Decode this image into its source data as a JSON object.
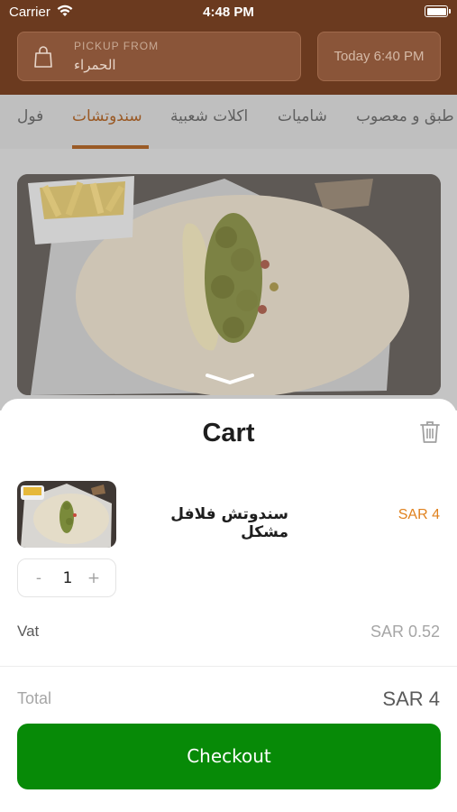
{
  "status_bar": {
    "carrier": "Carrier",
    "time": "4:48 PM"
  },
  "header": {
    "pickup_label": "PICKUP FROM",
    "pickup_location": "الحمراء",
    "pickup_time": "Today 6:40 PM"
  },
  "categories": [
    {
      "label": "فول",
      "active": false
    },
    {
      "label": "سندوتشات",
      "active": true
    },
    {
      "label": "اكلات شعبية",
      "active": false
    },
    {
      "label": "شاميات",
      "active": false
    },
    {
      "label": "طبق و معصوب",
      "active": false
    }
  ],
  "cart": {
    "title": "Cart",
    "item": {
      "name": "سندوتش فلافل مشكل",
      "price": "SAR 4",
      "quantity": "1",
      "minus": "-",
      "plus": "+"
    },
    "vat_label": "Vat",
    "vat_value": "SAR 0.52",
    "total_label": "Total",
    "total_value": "SAR 4",
    "checkout_label": "Checkout"
  },
  "colors": {
    "header_brown": "#6b3a1f",
    "active_tab": "#9a5a26",
    "price_orange": "#e0821f",
    "checkout_green": "#078a07"
  },
  "icons": [
    "wifi-icon",
    "battery-icon",
    "shopping-bag-icon",
    "chevron-down-icon",
    "trash-icon"
  ]
}
